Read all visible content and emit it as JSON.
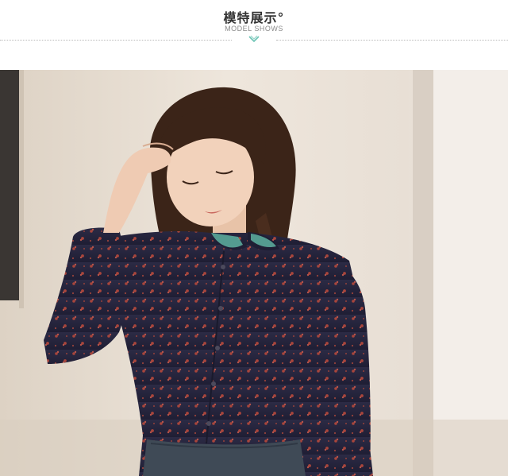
{
  "header": {
    "title_cn": "模特展示°",
    "title_en": "MODEL SHOWS"
  },
  "colors": {
    "title": "#333333",
    "subtitle": "#8a8a8a",
    "divider": "#b9b9b9",
    "chevron": "#6cc3b4",
    "shirt": "#27263f",
    "print": "#a9453b"
  },
  "icons": {
    "divider_chevron": "chevron-down-icon"
  }
}
